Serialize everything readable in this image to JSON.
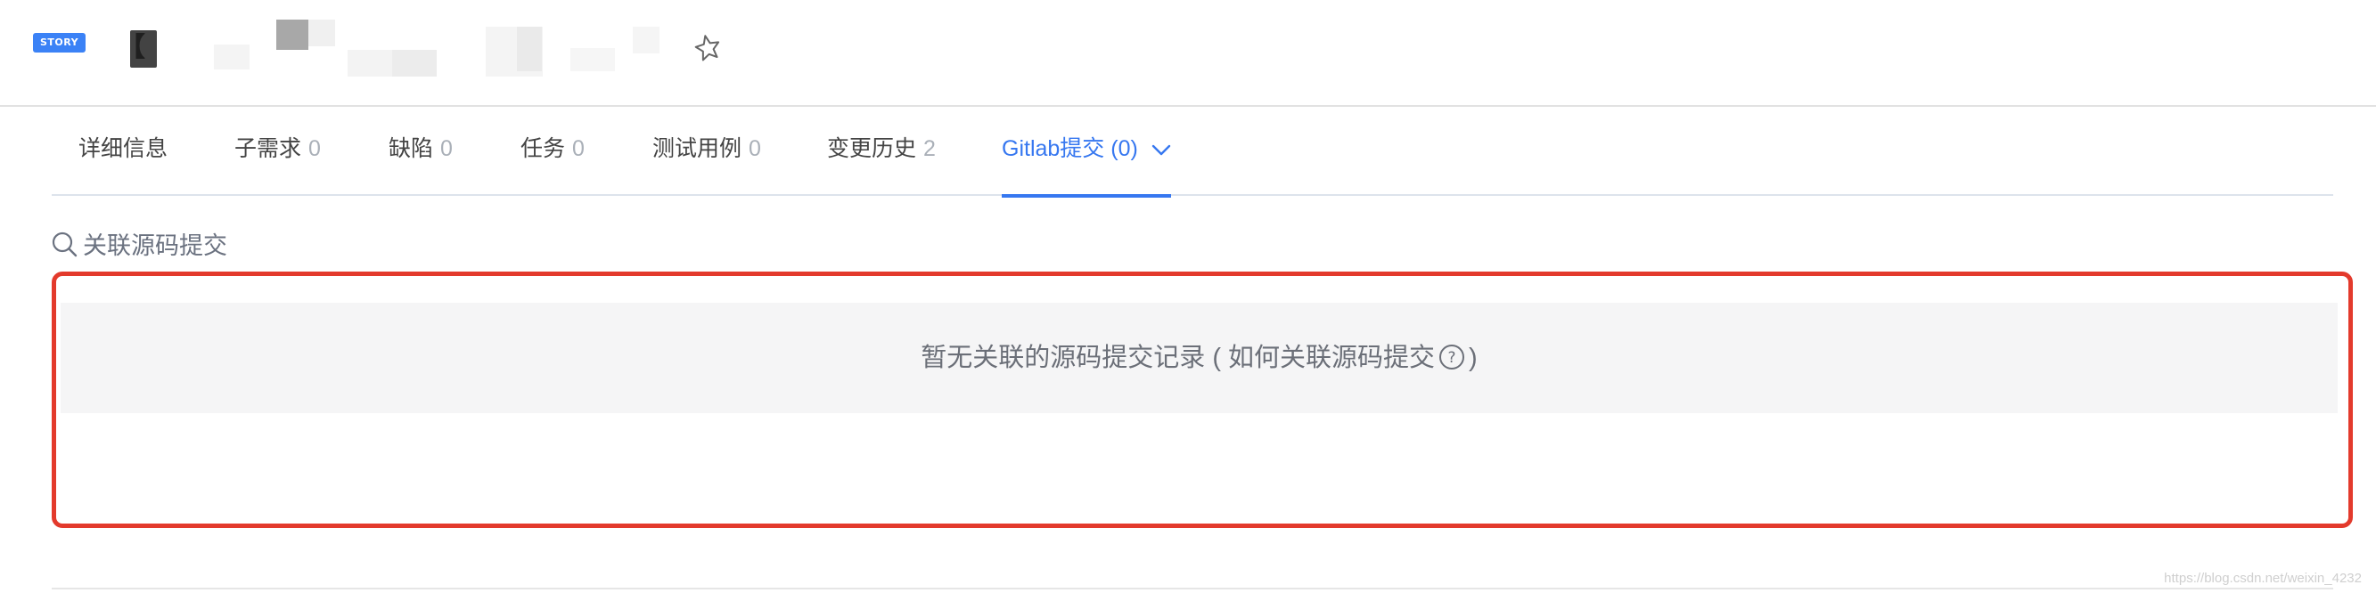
{
  "header": {
    "badge": "STORY",
    "title_prefix": "【",
    "star_icon": "star-outline-icon"
  },
  "tabs": [
    {
      "label": "详细信息",
      "count": ""
    },
    {
      "label": "子需求",
      "count": "0"
    },
    {
      "label": "缺陷",
      "count": "0"
    },
    {
      "label": "任务",
      "count": "0"
    },
    {
      "label": "测试用例",
      "count": "0"
    },
    {
      "label": "变更历史",
      "count": "2"
    },
    {
      "label": "Gitlab提交 (0)",
      "count": "",
      "active": true
    }
  ],
  "link_source": {
    "icon": "search-icon",
    "label": "关联源码提交"
  },
  "empty_state": {
    "message": "暂无关联的源码提交记录 ( 如何关联源码提交",
    "close_paren": ")",
    "help_icon": "question-circle-icon"
  },
  "watermark": "https://blog.csdn.net/weixin_4232",
  "colors": {
    "accent": "#3677f0",
    "badge": "#3b82f6",
    "highlight_frame": "#e33a2c",
    "empty_bg": "#f5f5f6"
  }
}
